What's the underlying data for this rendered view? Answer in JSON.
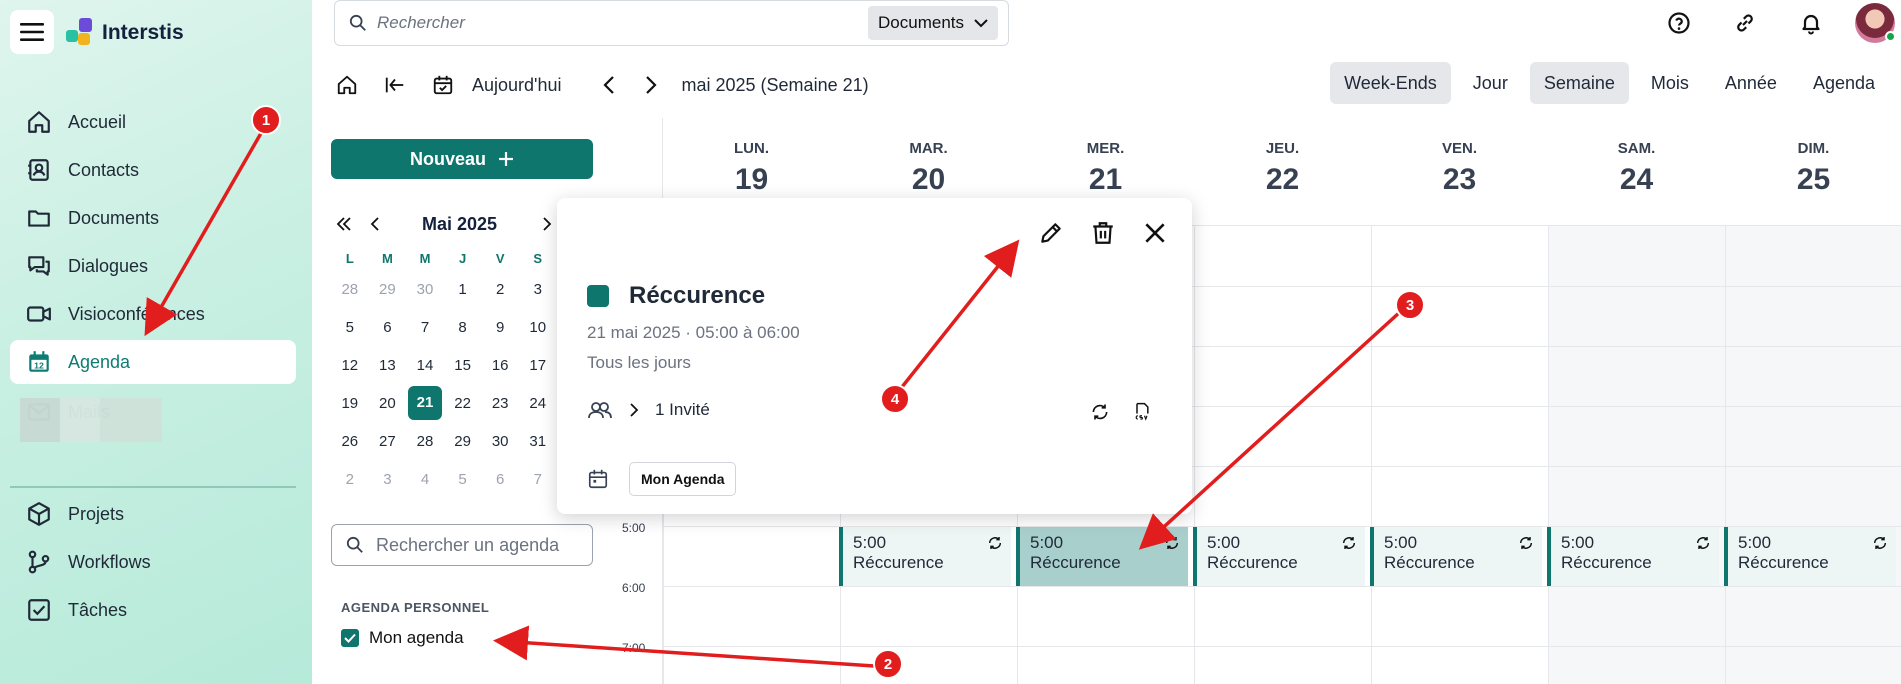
{
  "app": {
    "name": "Interstis"
  },
  "sidebar": {
    "nav": [
      {
        "label": "Accueil",
        "icon": "home-icon"
      },
      {
        "label": "Contacts",
        "icon": "contacts-icon"
      },
      {
        "label": "Documents",
        "icon": "folder-icon"
      },
      {
        "label": "Dialogues",
        "icon": "chat-icon"
      },
      {
        "label": "Visioconférences",
        "icon": "video-icon"
      },
      {
        "label": "Agenda",
        "icon": "calendar-icon",
        "active": true
      },
      {
        "label": "Mails",
        "icon": "mail-icon"
      }
    ],
    "nav2": [
      {
        "label": "Projets",
        "icon": "box-icon"
      },
      {
        "label": "Workflows",
        "icon": "workflow-icon"
      },
      {
        "label": "Tâches",
        "icon": "checkbox-icon"
      }
    ]
  },
  "search": {
    "placeholder": "Rechercher",
    "scope": "Documents"
  },
  "toolbar": {
    "today": "Aujourd'hui",
    "period": "mai 2025 (Semaine 21)"
  },
  "views": [
    "Week-Ends",
    "Jour",
    "Semaine",
    "Mois",
    "Année",
    "Agenda"
  ],
  "new_button": "Nouveau",
  "mini_calendar": {
    "title": "Mai 2025",
    "dow": [
      "L",
      "M",
      "M",
      "J",
      "V",
      "S"
    ],
    "weeks": [
      [
        "28",
        "29",
        "30",
        "1",
        "2",
        "3"
      ],
      [
        "5",
        "6",
        "7",
        "8",
        "9",
        "10"
      ],
      [
        "12",
        "13",
        "14",
        "15",
        "16",
        "17"
      ],
      [
        "19",
        "20",
        "21",
        "22",
        "23",
        "24"
      ],
      [
        "26",
        "27",
        "28",
        "29",
        "30",
        "31"
      ],
      [
        "2",
        "3",
        "4",
        "5",
        "6",
        "7"
      ]
    ],
    "today": "21"
  },
  "agenda_search": {
    "placeholder": "Rechercher un agenda"
  },
  "personal": {
    "section": "AGENDA PERSONNEL",
    "calendar": "Mon agenda"
  },
  "week": {
    "days": [
      {
        "dow": "LUN.",
        "num": "19"
      },
      {
        "dow": "MAR.",
        "num": "20"
      },
      {
        "dow": "MER.",
        "num": "21"
      },
      {
        "dow": "JEU.",
        "num": "22"
      },
      {
        "dow": "VEN.",
        "num": "23"
      },
      {
        "dow": "SAM.",
        "num": "24"
      },
      {
        "dow": "DIM.",
        "num": "25"
      }
    ],
    "times": [
      "5:00",
      "6:00",
      "7:00"
    ],
    "event": {
      "time": "5:00",
      "title": "Réccurence"
    }
  },
  "popover": {
    "title": "Réccurence",
    "color": "#0f766e",
    "date": "21 mai 2025 · 05:00 à 06:00",
    "recurrence": "Tous les jours",
    "guests": "1 Invité",
    "calendar": "Mon Agenda"
  },
  "markers": [
    "1",
    "2",
    "3",
    "4"
  ],
  "colors": {
    "accent": "#0f766e",
    "annotation": "#e11d1d"
  }
}
